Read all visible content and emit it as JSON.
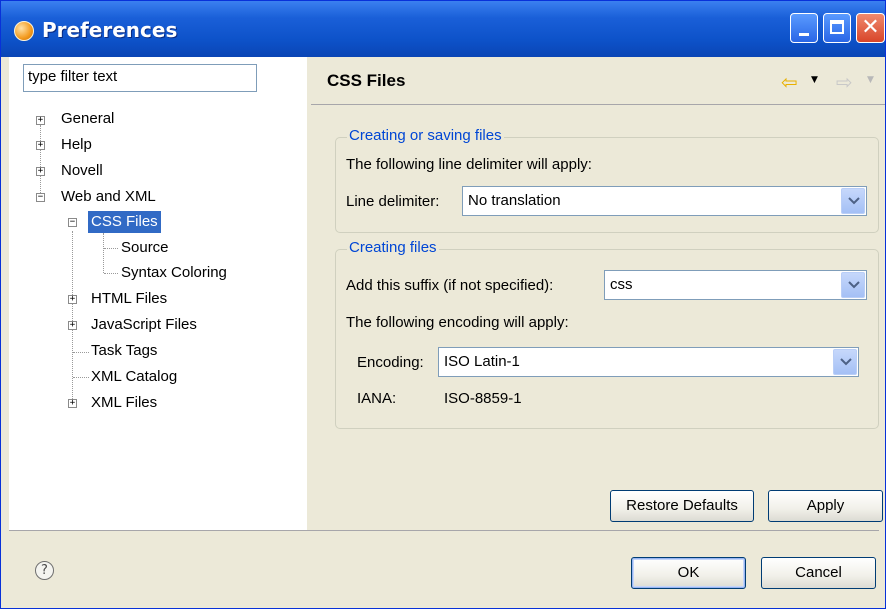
{
  "window": {
    "title": "Preferences"
  },
  "filter": {
    "placeholder": "type filter text"
  },
  "tree": {
    "general": "General",
    "help": "Help",
    "novell": "Novell",
    "web_and_xml": "Web and XML",
    "css_files": "CSS Files",
    "source": "Source",
    "syntax_coloring": "Syntax Coloring",
    "html_files": "HTML Files",
    "javascript_files": "JavaScript Files",
    "task_tags": "Task Tags",
    "xml_catalog": "XML Catalog",
    "xml_files": "XML Files",
    "selected": "CSS Files"
  },
  "page": {
    "title": "CSS Files",
    "group1": {
      "legend": "Creating or saving files",
      "description": "The following line delimiter will apply:",
      "line_delimiter_label": "Line delimiter:",
      "line_delimiter_value": "No translation"
    },
    "group2": {
      "legend": "Creating files",
      "suffix_label": "Add this suffix (if not specified):",
      "suffix_value": "css",
      "encoding_description": "The following encoding will apply:",
      "encoding_label": "Encoding:",
      "encoding_value": "ISO Latin-1",
      "iana_label": "IANA:",
      "iana_value": "ISO-8859-1"
    },
    "restore_defaults": "Restore Defaults",
    "apply": "Apply"
  },
  "dialog": {
    "ok": "OK",
    "cancel": "Cancel",
    "help_glyph": "?"
  },
  "icons": {
    "back": "back-arrow-icon",
    "forward": "forward-arrow-icon",
    "dropdown": "chevron-down-icon",
    "help": "help-icon"
  },
  "colors": {
    "titlebar": "#0d52c9",
    "selection": "#316ac5",
    "group_legend": "#0046d5",
    "back_arrow": "#e8b000",
    "forward_arrow": "#c8c8c8"
  }
}
